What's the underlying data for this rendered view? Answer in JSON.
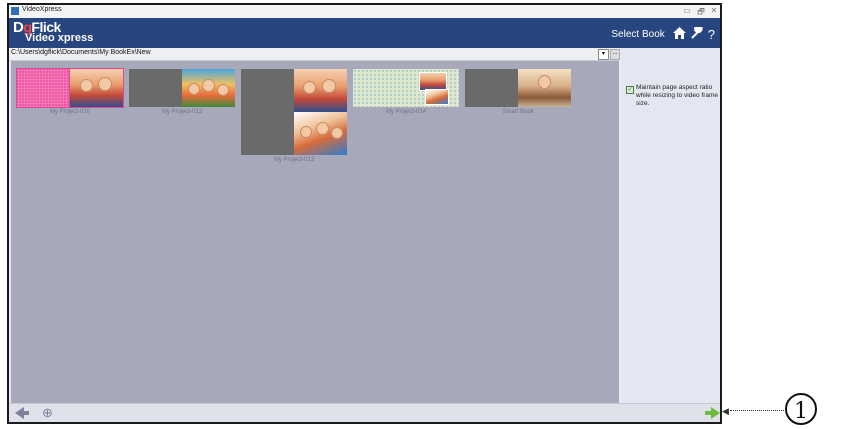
{
  "window": {
    "title": "VideoXpress",
    "controls": [
      "▭",
      "🗗",
      "✕"
    ]
  },
  "header": {
    "logo_line1_d": "D",
    "logo_line1_g": "g",
    "logo_line1_rest": "Flick",
    "logo_line2": "Video xpress",
    "select_book": "Select Book",
    "icons": [
      "home-icon",
      "wrench-icon",
      "help-icon"
    ],
    "help_glyph": "?"
  },
  "pathbar": {
    "path": "C:\\Users\\dgflick\\Documents\\My BookEx\\New",
    "dropdown": "▾",
    "more": "..."
  },
  "projects": [
    {
      "label": "My Project-010"
    },
    {
      "label": "My Project-012"
    },
    {
      "label": "My Project-013"
    },
    {
      "label": "My Project-014"
    },
    {
      "label": "Smart Book"
    }
  ],
  "settings": {
    "maintain_aspect": "Maintain page aspect ratio while resizing to video frame size.",
    "checked": true
  },
  "bottombar": {
    "zoom_glyph": "⊕"
  },
  "callout": {
    "number": "1"
  },
  "colors": {
    "header": "#27457f",
    "grid": "#a7a9ba",
    "next_arrow": "#6dbd3c"
  }
}
